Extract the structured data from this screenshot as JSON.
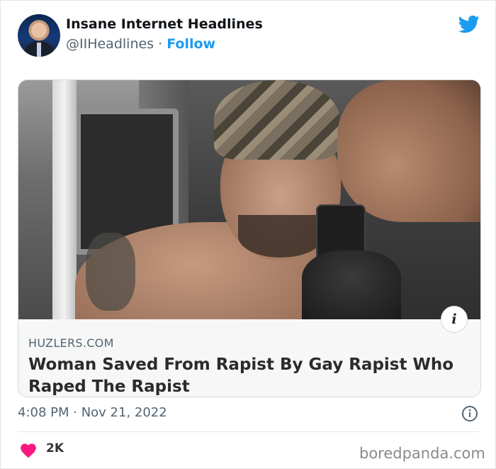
{
  "tweet": {
    "display_name": "Insane Internet Headlines",
    "handle": "@IIHeadlines",
    "separator": "·",
    "follow_label": "Follow",
    "timestamp": "4:08 PM · Nov 21, 2022",
    "likes_count": "2K"
  },
  "card": {
    "domain": "HUZLERS.COM",
    "headline": "Woman Saved From Rapist By Gay Rapist Who Raped The Rapist",
    "info_badge": "i"
  },
  "watermark": "boredpanda.com",
  "colors": {
    "accent": "#1d9bf0",
    "heart": "#f91880",
    "muted": "#536471"
  },
  "icons": {
    "brand": "twitter-bird-icon",
    "info": "info-circle-icon",
    "like": "heart-icon"
  }
}
